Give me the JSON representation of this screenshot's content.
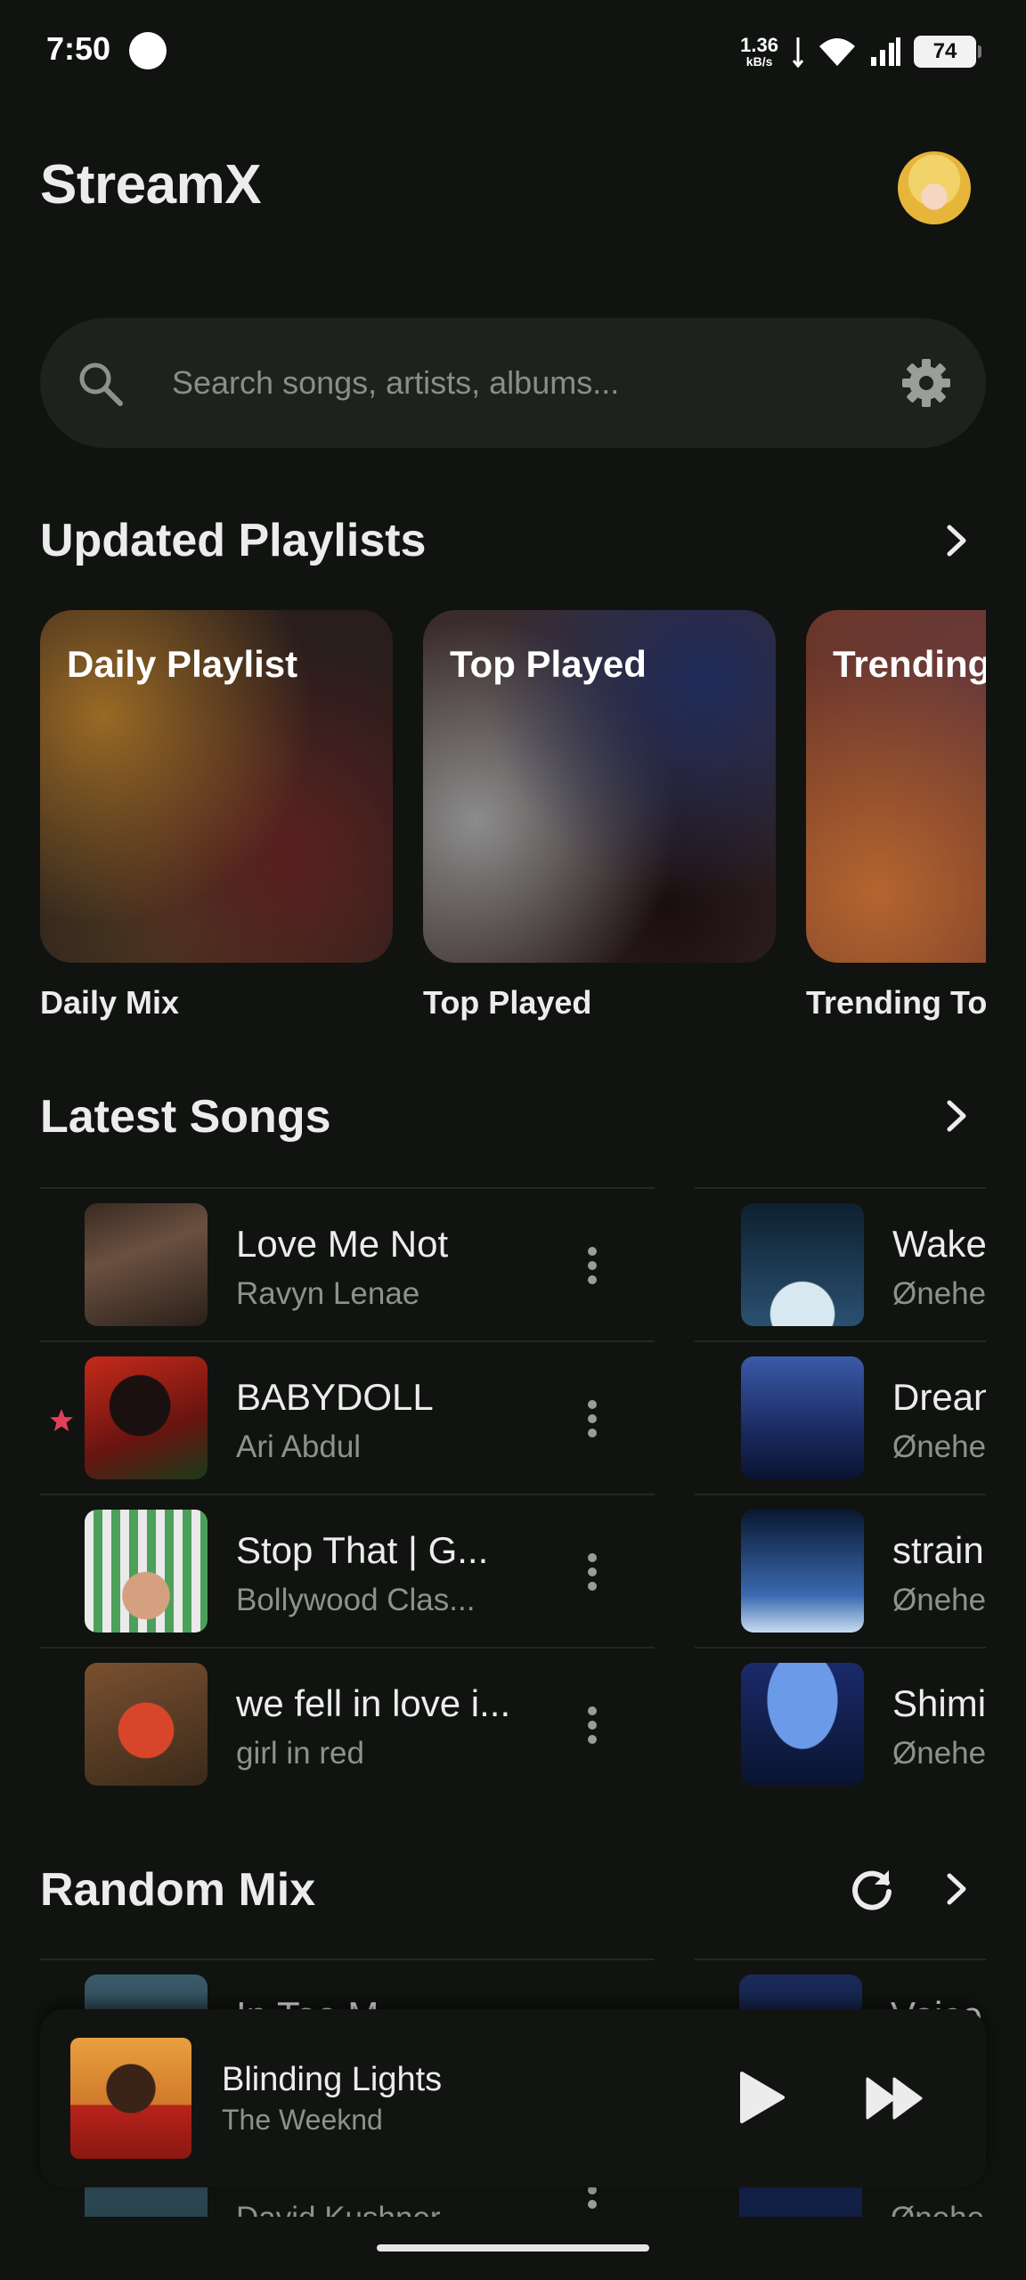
{
  "status_bar": {
    "time": "7:50",
    "net_speed_value": "1.36",
    "net_speed_unit": "kB/s",
    "battery": "74"
  },
  "app": {
    "title": "StreamX"
  },
  "search": {
    "placeholder": "Search songs, artists, albums..."
  },
  "updated_playlists": {
    "title": "Updated Playlists",
    "items": [
      {
        "cover_text": "Daily Playlist",
        "name": "Daily Mix"
      },
      {
        "cover_text": "Top Played",
        "name": "Top Played"
      },
      {
        "cover_text": "Trending Today",
        "name": "Trending Today"
      }
    ]
  },
  "latest_songs": {
    "title": "Latest Songs",
    "left": [
      {
        "title": "Love Me Not",
        "artist": "Ravyn Lenae",
        "favorite": false
      },
      {
        "title": "BABYDOLL",
        "artist": "Ari Abdul",
        "favorite": true
      },
      {
        "title": "Stop That |  G...",
        "artist": "Bollywood Clas...",
        "favorite": false
      },
      {
        "title": "we fell in love i...",
        "artist": "girl in red",
        "favorite": false
      }
    ],
    "right": [
      {
        "title": "Wake",
        "artist": "Ønehe"
      },
      {
        "title": "Drean",
        "artist": "Ønehe"
      },
      {
        "title": "strain",
        "artist": "Ønehe"
      },
      {
        "title": "Shimi",
        "artist": "Ønehe"
      }
    ]
  },
  "random_mix": {
    "title": "Random Mix",
    "left": [
      {
        "title": "In Too M",
        "artist": ""
      },
      {
        "title": "",
        "artist": "David Kushner"
      }
    ],
    "right": [
      {
        "title": "Voice",
        "artist": ""
      },
      {
        "title": "",
        "artist": "Ønehe"
      }
    ]
  },
  "now_playing": {
    "title": "Blinding Lights",
    "artist": "The Weeknd"
  },
  "colors": {
    "background": "#101310",
    "surface": "#1e221e",
    "accent_star": "#e0405a",
    "text_primary": "#ececec",
    "text_secondary": "#8e918e"
  },
  "icons": [
    "search-icon",
    "settings-icon",
    "chevron-right-icon",
    "more-vertical-icon",
    "star-icon",
    "refresh-icon",
    "play-icon",
    "skip-forward-icon",
    "wifi-icon",
    "signal-icon"
  ]
}
